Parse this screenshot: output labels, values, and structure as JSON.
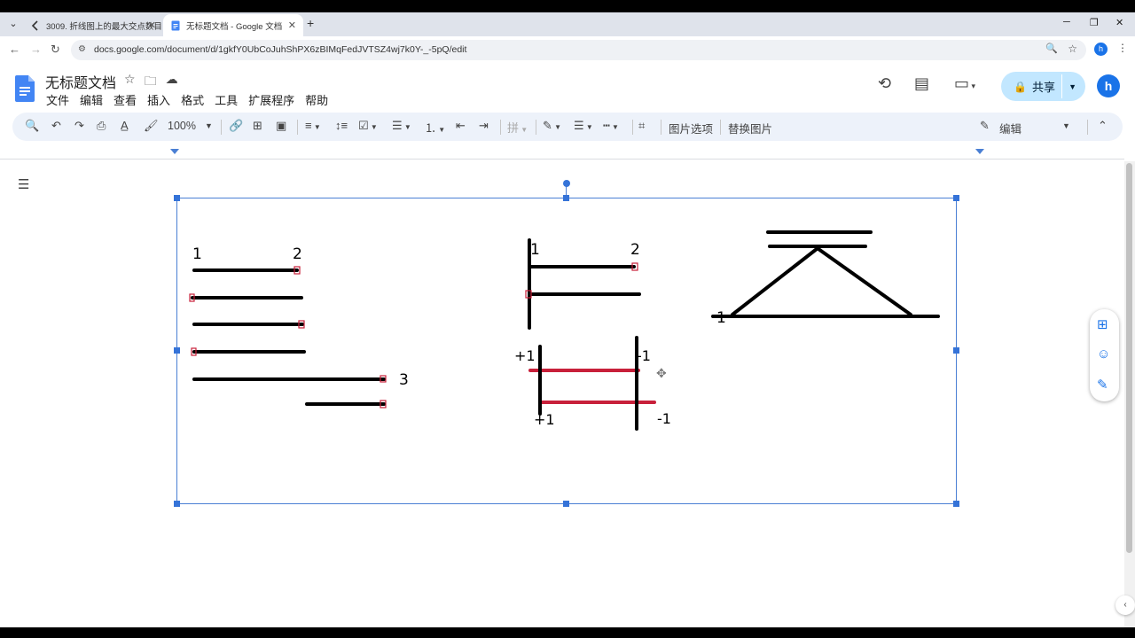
{
  "browser": {
    "tabs": [
      {
        "label": "3009. 折线图上的最大交点数目"
      },
      {
        "label": "无标题文档 - Google 文档"
      }
    ],
    "url": "docs.google.com/document/d/1gkfY0UbCoJuhShPX6zBIMqFedJVTSZ4wj7k0Y-_-5pQ/edit",
    "profile_initial": "h"
  },
  "docs": {
    "title": "无标题文档",
    "menu": [
      "文件",
      "编辑",
      "查看",
      "插入",
      "格式",
      "工具",
      "扩展程序",
      "帮助"
    ],
    "share_label": "共享",
    "avatar_initial": "h",
    "toolbar": {
      "zoom": "100%",
      "image_options": "图片选项",
      "replace_image": "替换图片",
      "mode": "编辑",
      "pinyin": "拼"
    }
  },
  "drawing": {
    "left_labels": [
      "1",
      "2",
      "3"
    ],
    "mid_top_labels": [
      "1",
      "2"
    ],
    "mid_bottom_labels": [
      "+1",
      "-1",
      "+1",
      "-1"
    ],
    "right_label": "1",
    "accent_red": "#c8203a"
  }
}
